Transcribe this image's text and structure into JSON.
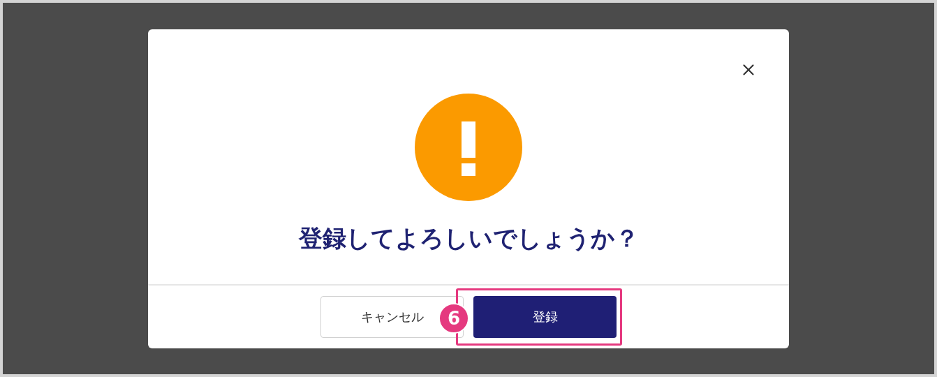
{
  "dialog": {
    "message": "登録してよろしいでしょうか？",
    "buttons": [
      {
        "label": "キャンセル",
        "kind": "secondary"
      },
      {
        "label": "登録",
        "kind": "primary"
      }
    ]
  },
  "annotation": {
    "number": "6"
  }
}
